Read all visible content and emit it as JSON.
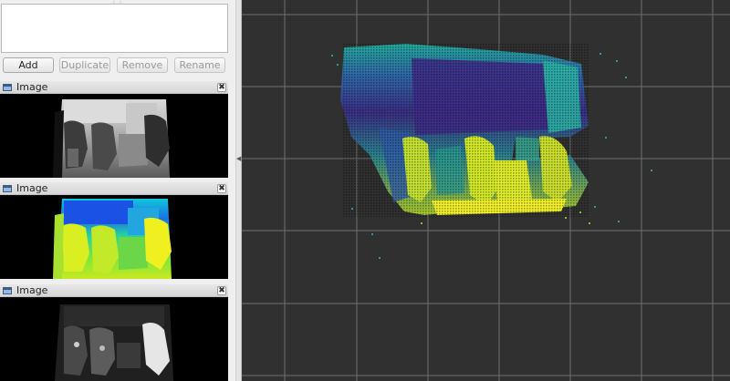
{
  "displays_panel": {
    "buttons": {
      "add": "Add",
      "duplicate": "Duplicate",
      "remove": "Remove",
      "rename": "Rename"
    }
  },
  "image_panels": [
    {
      "title": "Image",
      "content": "depth-grayscale",
      "close_symbol": "✖"
    },
    {
      "title": "Image",
      "content": "depth-colormap",
      "close_symbol": "✖"
    },
    {
      "title": "Image",
      "content": "ir-grayscale",
      "close_symbol": "✖"
    }
  ],
  "viewport": {
    "background": "#303030",
    "grid_color": "#8a8a8a",
    "content": "point-cloud"
  },
  "icons": {
    "panel_icon": "window-icon",
    "close": "close-icon",
    "splitter": "collapse-arrow-icon"
  }
}
